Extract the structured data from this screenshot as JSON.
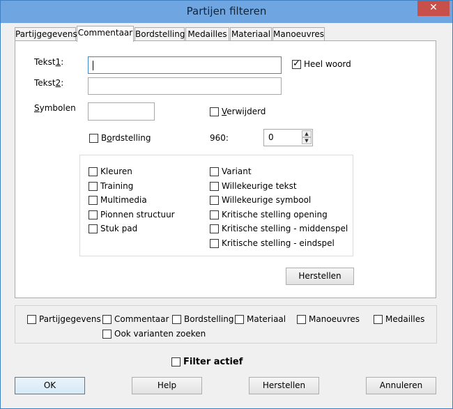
{
  "window": {
    "title": "Partijen filteren",
    "close_symbol": "✕"
  },
  "tabs": [
    {
      "label": "Partijgegevens"
    },
    {
      "label": "Commentaar"
    },
    {
      "label": "Bordstelling"
    },
    {
      "label": "Medailles"
    },
    {
      "label": "Materiaal"
    },
    {
      "label": "Manoeuvres"
    }
  ],
  "commentaar": {
    "tekst1": {
      "label_pre": "Tekst",
      "label_mnemonic": "1",
      "label_post": ":",
      "value": ""
    },
    "tekst2": {
      "label_pre": "Tekst",
      "label_mnemonic": "2",
      "label_post": ":",
      "value": ""
    },
    "heel_woord": {
      "label": "Heel woord",
      "checked": true
    },
    "symbolen": {
      "label_mnemonic": "S",
      "label_rest": "ymbolen",
      "value": ""
    },
    "verwijderd": {
      "label_mnemonic": "V",
      "label_rest": "erwijderd",
      "checked": false
    },
    "bordstelling": {
      "label_pre": "B",
      "label_mnemonic": "o",
      "label_post": "rdstelling",
      "checked": false
    },
    "spin": {
      "label": "960:",
      "value": "0",
      "up": "▲",
      "down": "▼"
    },
    "options_left": [
      {
        "label": "Kleuren",
        "checked": false
      },
      {
        "label": "Training",
        "checked": false
      },
      {
        "label": "Multimedia",
        "checked": false
      },
      {
        "label": "Pionnen structuur",
        "checked": false
      },
      {
        "label": "Stuk pad",
        "checked": false
      }
    ],
    "options_right": [
      {
        "label": "Variant",
        "checked": false
      },
      {
        "label": "Willekeurige tekst",
        "checked": false
      },
      {
        "label": "Willekeurige symbool",
        "checked": false
      },
      {
        "label": "Kritische stelling opening",
        "checked": false
      },
      {
        "label": "Kritische stelling - middenspel",
        "checked": false
      },
      {
        "label": "Kritische stelling - eindspel",
        "checked": false
      }
    ],
    "herstellen_label": "Herstellen"
  },
  "filters": [
    {
      "label": "Partijgegevens",
      "checked": false
    },
    {
      "label": "Commentaar",
      "checked": false
    },
    {
      "label": "Bordstelling",
      "checked": false
    },
    {
      "label": "Materiaal",
      "checked": false
    },
    {
      "label": "Manoeuvres",
      "checked": false
    },
    {
      "label": "Medailles",
      "checked": false
    },
    {
      "label": "Ook varianten zoeken",
      "checked": false
    }
  ],
  "filter_actief": {
    "label": "Filter actief",
    "checked": false
  },
  "buttons": {
    "ok": "OK",
    "help": "Help",
    "herstellen": "Herstellen",
    "annuleren": "Annuleren"
  }
}
